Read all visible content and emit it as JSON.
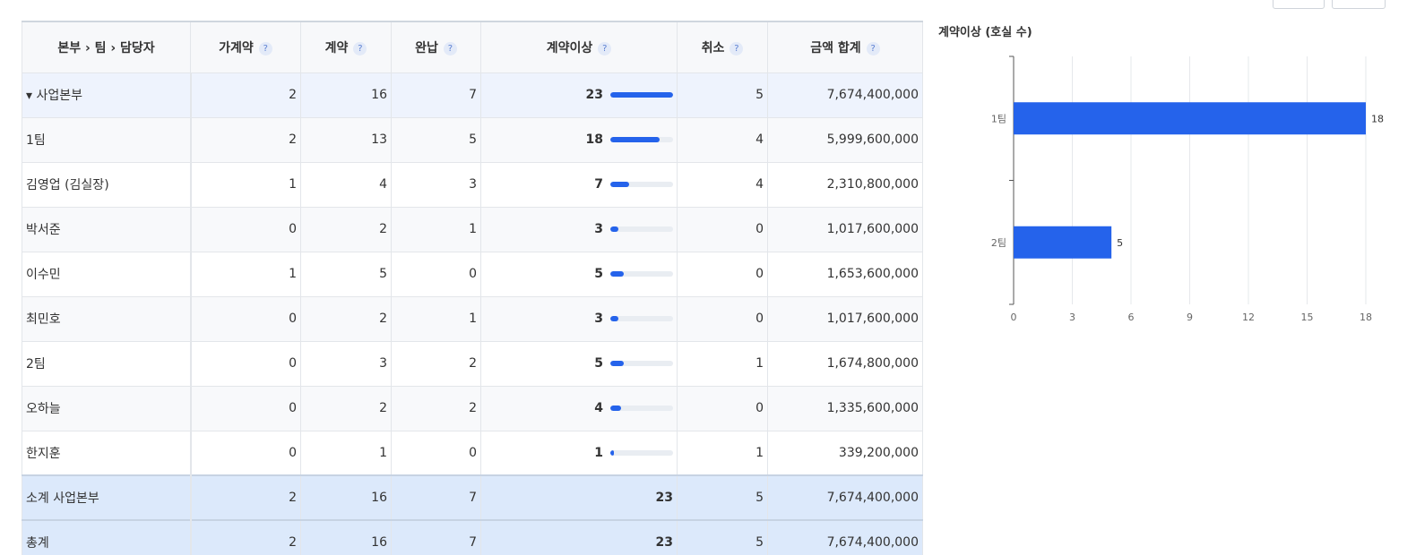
{
  "columns": [
    {
      "label": "본부 › 팀 › 담당자",
      "help": ""
    },
    {
      "label": "가계약",
      "help": "?"
    },
    {
      "label": "계약",
      "help": "?"
    },
    {
      "label": "완납",
      "help": "?"
    },
    {
      "label": "계약이상",
      "help": "?"
    },
    {
      "label": "취소",
      "help": "?"
    },
    {
      "label": "금액 합계",
      "help": "?"
    }
  ],
  "rows": [
    {
      "kind": "hq",
      "name": "▾ 사업본부",
      "c1": "2",
      "c2": "16",
      "c3": "7",
      "issue": "23",
      "issue_frac": 1.0,
      "cancel": "5",
      "amount": "7,674,400,000"
    },
    {
      "kind": "team",
      "name": "1팀",
      "c1": "2",
      "c2": "13",
      "c3": "5",
      "issue": "18",
      "issue_frac": 0.78,
      "cancel": "4",
      "amount": "5,999,600,000"
    },
    {
      "kind": "person",
      "name": "김영업 (김실장)",
      "c1": "1",
      "c2": "4",
      "c3": "3",
      "issue": "7",
      "issue_frac": 0.3,
      "cancel": "4",
      "amount": "2,310,800,000"
    },
    {
      "kind": "person",
      "name": "박서준",
      "c1": "0",
      "c2": "2",
      "c3": "1",
      "issue": "3",
      "issue_frac": 0.13,
      "cancel": "0",
      "amount": "1,017,600,000"
    },
    {
      "kind": "person",
      "name": "이수민",
      "c1": "1",
      "c2": "5",
      "c3": "0",
      "issue": "5",
      "issue_frac": 0.22,
      "cancel": "0",
      "amount": "1,653,600,000"
    },
    {
      "kind": "person",
      "name": "최민호",
      "c1": "0",
      "c2": "2",
      "c3": "1",
      "issue": "3",
      "issue_frac": 0.13,
      "cancel": "0",
      "amount": "1,017,600,000"
    },
    {
      "kind": "team",
      "name": "2팀",
      "c1": "0",
      "c2": "3",
      "c3": "2",
      "issue": "5",
      "issue_frac": 0.22,
      "cancel": "1",
      "amount": "1,674,800,000"
    },
    {
      "kind": "person",
      "name": "오하늘",
      "c1": "0",
      "c2": "2",
      "c3": "2",
      "issue": "4",
      "issue_frac": 0.17,
      "cancel": "0",
      "amount": "1,335,600,000"
    },
    {
      "kind": "person",
      "name": "한지훈",
      "c1": "0",
      "c2": "1",
      "c3": "0",
      "issue": "1",
      "issue_frac": 0.04,
      "cancel": "1",
      "amount": "339,200,000"
    },
    {
      "kind": "subtotal",
      "name": "소계 사업본부",
      "c1": "2",
      "c2": "16",
      "c3": "7",
      "issue": "23",
      "cancel": "5",
      "amount": "7,674,400,000"
    },
    {
      "kind": "total",
      "name": "총계",
      "c1": "2",
      "c2": "16",
      "c3": "7",
      "issue": "23",
      "cancel": "5",
      "amount": "7,674,400,000"
    }
  ],
  "colors": {
    "accent": "#2563eb",
    "bar_track": "#e9edf2",
    "hq_row": "#eef3fd",
    "total_row": "#dce9fb"
  },
  "chart_data": {
    "type": "bar",
    "orientation": "horizontal",
    "title": "계약이상 (호실 수)",
    "categories": [
      "1팀",
      "2팀"
    ],
    "values": [
      18,
      5
    ],
    "xlim": [
      0,
      18
    ],
    "xticks": [
      0,
      3,
      6,
      9,
      12,
      15,
      18
    ],
    "grid": true,
    "color": "#2563eb"
  }
}
